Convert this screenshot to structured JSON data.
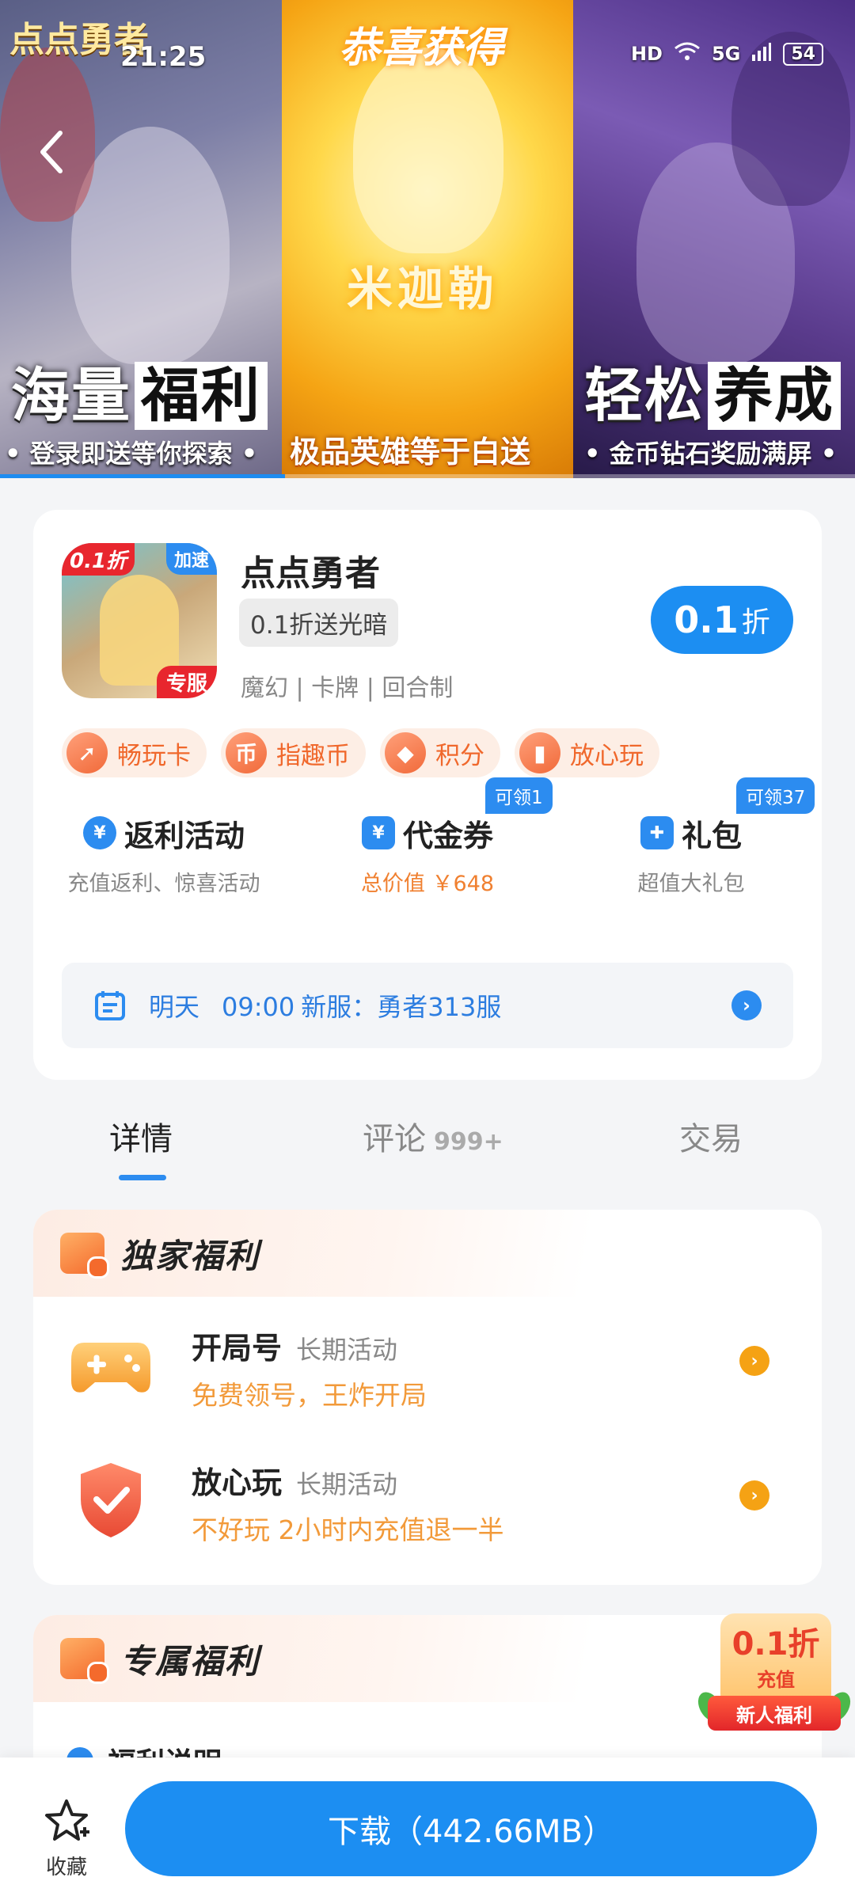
{
  "status_bar": {
    "time": "21:25",
    "hd": "HD",
    "network": "5G",
    "battery": "54"
  },
  "banner": {
    "logo": "点点勇者",
    "slides": [
      {
        "title_plain": "海量",
        "title_boxed": "福利",
        "subtitle": "• 登录即送等你探索 •"
      },
      {
        "title": "恭喜获得",
        "hero_name": "米迦勒",
        "subtitle": "极品英雄等于白送"
      },
      {
        "title_plain": "轻松",
        "title_boxed": "养成",
        "subtitle": "• 金币钻石奖励满屏 •"
      }
    ],
    "progress_fraction": 0.333
  },
  "app": {
    "icon_tags": {
      "left": "0.1折",
      "right": "加速",
      "bottom": "专服"
    },
    "name": "点点勇者",
    "badge": "0.1折送光暗",
    "tags": "魔幻 | 卡牌 | 回合制",
    "discount": {
      "value": "0.1",
      "unit": "折"
    },
    "chips": [
      {
        "icon": "shoe-icon",
        "glyph": "➚",
        "label": "畅玩卡"
      },
      {
        "icon": "coin-icon",
        "glyph": "币",
        "label": "指趣币"
      },
      {
        "icon": "diamond-icon",
        "glyph": "◆",
        "label": "积分"
      },
      {
        "icon": "shield-play-icon",
        "glyph": "▮",
        "label": "放心玩"
      }
    ],
    "features": [
      {
        "icon": "rebate-icon",
        "glyph": "¥",
        "title": "返利活动",
        "subtitle": "充值返利、惊喜活动",
        "claim": ""
      },
      {
        "icon": "voucher-icon",
        "glyph": "¥",
        "title": "代金券",
        "subtitle": "总价值 ￥648",
        "claim": "可领1"
      },
      {
        "icon": "gift-icon",
        "glyph": "✚",
        "title": "礼包",
        "subtitle": "超值大礼包",
        "claim": "可领37"
      }
    ],
    "server": {
      "day": "明天",
      "time": "09:00",
      "text": "新服：勇者313服"
    }
  },
  "tabs": [
    {
      "label": "详情",
      "count": ""
    },
    {
      "label": "评论",
      "count": "999+"
    },
    {
      "label": "交易",
      "count": ""
    }
  ],
  "welfare": {
    "title": "独家福利",
    "items": [
      {
        "icon": "gamepad-icon",
        "title": "开局号",
        "tag": "长期活动",
        "desc": "免费领号，王炸开局"
      },
      {
        "icon": "shield-check-icon",
        "title": "放心玩",
        "tag": "长期活动",
        "desc": "不好玩 2小时内充值退一半"
      }
    ]
  },
  "exclusive": {
    "title": "专属福利",
    "item": "福利说明"
  },
  "promo": {
    "big": "0.1折",
    "small": "充值",
    "ribbon": "新人福利"
  },
  "bottom": {
    "favorite_label": "收藏",
    "download_label": "下载（442.66MB）"
  },
  "colors": {
    "primary": "#1c8ef2",
    "accent_orange": "#f0682c",
    "welfare_orange": "#f29a3a"
  }
}
